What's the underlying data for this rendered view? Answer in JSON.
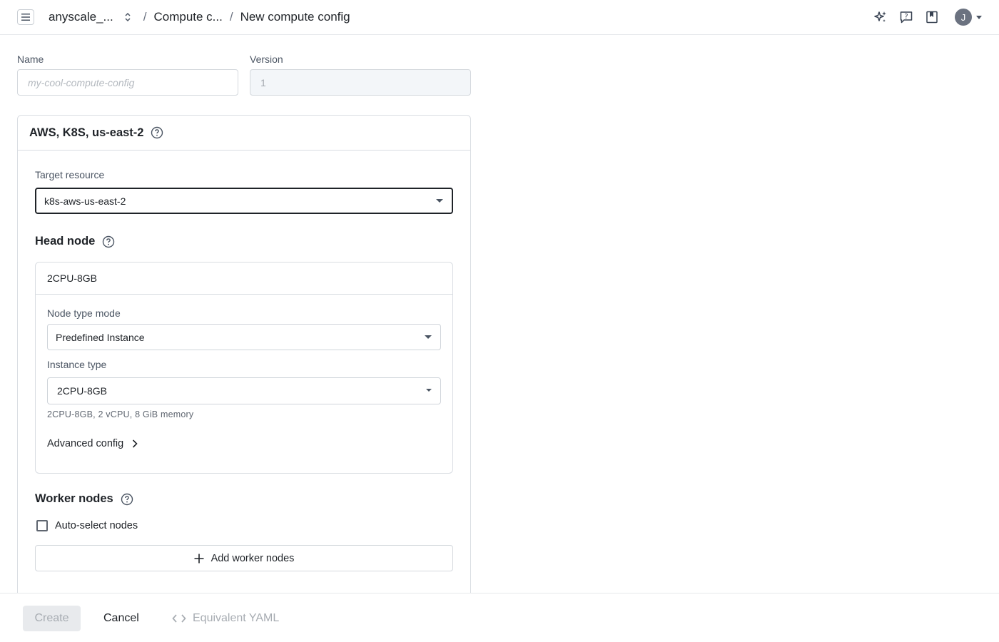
{
  "header": {
    "org": "anyscale_...",
    "breadcrumb_section": "Compute c...",
    "breadcrumb_separator": "/",
    "breadcrumb_current": "New compute config",
    "avatar_initial": "J"
  },
  "form": {
    "name_label": "Name",
    "name_placeholder": "my-cool-compute-config",
    "version_label": "Version",
    "version_value": "1"
  },
  "cloud_card": {
    "title": "AWS, K8S, us-east-2",
    "target_resource_label": "Target resource",
    "target_resource_value": "k8s-aws-us-east-2",
    "head_node": {
      "title": "Head node",
      "card_title": "2CPU-8GB",
      "node_type_mode_label": "Node type mode",
      "node_type_mode_value": "Predefined Instance",
      "instance_type_label": "Instance type",
      "instance_type_value": "2CPU-8GB",
      "instance_helper": "2CPU-8GB, 2 vCPU, 8 GiB memory",
      "advanced_config": "Advanced config"
    },
    "worker_nodes": {
      "title": "Worker nodes",
      "auto_select_label": "Auto-select nodes",
      "auto_select_checked": false,
      "add_button": "Add worker nodes"
    }
  },
  "footer": {
    "create": "Create",
    "cancel": "Cancel",
    "yaml": "Equivalent YAML"
  },
  "icons": [
    "menu-icon",
    "unfold-icon",
    "sparkle-icon",
    "help-chat-icon",
    "bookmark-icon",
    "chevron-down-icon",
    "help-circle-icon",
    "chevron-right-icon",
    "plus-icon",
    "code-icon"
  ]
}
